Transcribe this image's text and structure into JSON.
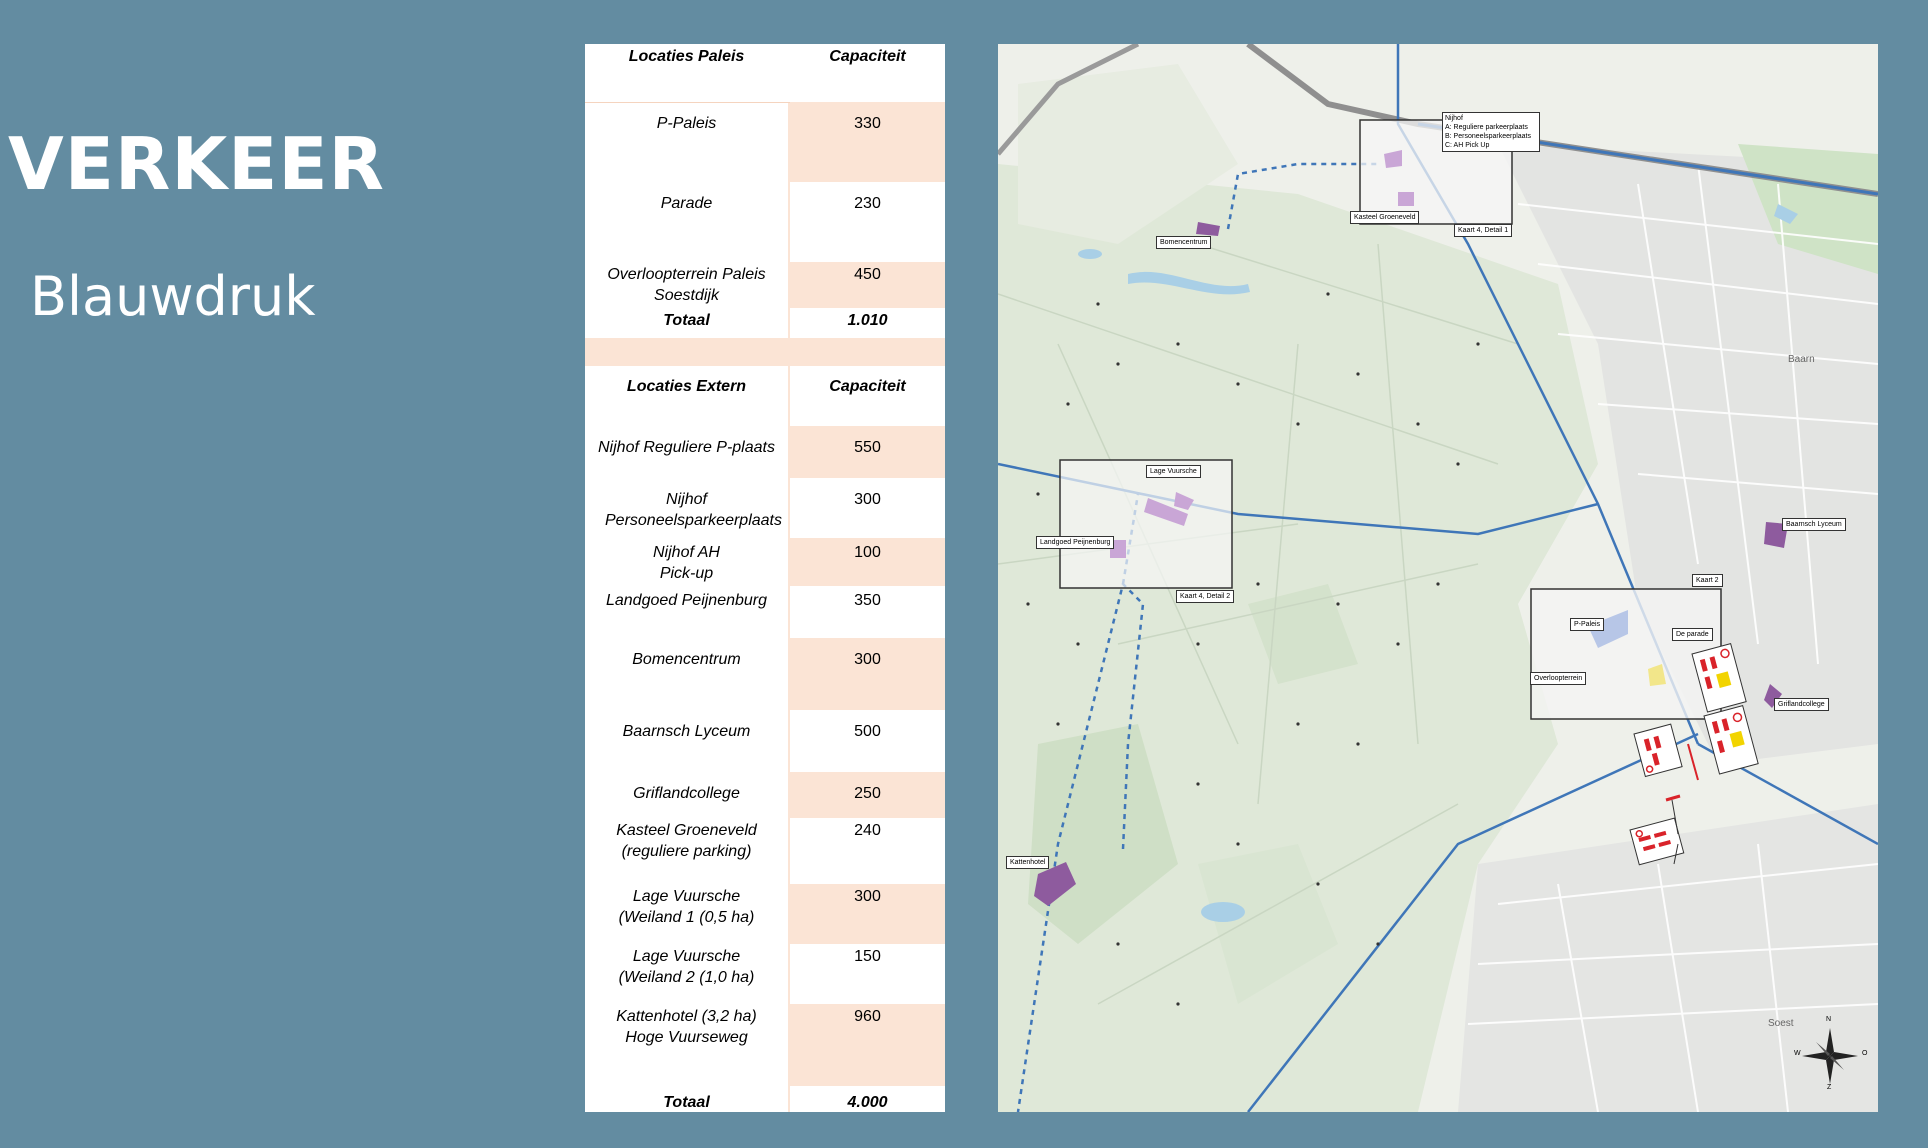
{
  "slide": {
    "title": "VERKEER",
    "subtitle": "Blauwdruk"
  },
  "table": {
    "section1": {
      "header": [
        "Locaties Paleis",
        "Capaciteit"
      ],
      "rows": [
        {
          "name": "P-Paleis",
          "capacity": "330"
        },
        {
          "name": "Parade",
          "capacity": "230"
        },
        {
          "name": "Overloopterrein Paleis Soestdijk",
          "capacity": "450"
        }
      ],
      "total": {
        "label": "Totaal",
        "value": "1.010"
      }
    },
    "section2": {
      "header": [
        "Locaties Extern",
        "Capaciteit"
      ],
      "rows": [
        {
          "name": "Nijhof Reguliere P-plaats",
          "capacity": "550"
        },
        {
          "name": "Nijhof Personeelsparkeerplaats",
          "capacity": "300"
        },
        {
          "name": "Nijhof AH Pick-up",
          "capacity": "100"
        },
        {
          "name": "Landgoed Peijnenburg",
          "capacity": "350"
        },
        {
          "name": "Bomencentrum",
          "capacity": "300"
        },
        {
          "name": "Baarnsch Lyceum",
          "capacity": "500"
        },
        {
          "name": "Griflandcollege",
          "capacity": "250"
        },
        {
          "name": "Kasteel Groeneveld (reguliere parking)",
          "capacity": "240"
        },
        {
          "name": "Lage Vuursche (Weiland 1 (0,5 ha)",
          "capacity": "300"
        },
        {
          "name": "Lage Vuursche (Weiland 2 (1,0 ha)",
          "capacity": "150"
        },
        {
          "name": "Kattenhotel (3,2 ha) Hoge Vuurseweg",
          "capacity": "960"
        }
      ],
      "total": {
        "label": "Totaal",
        "value": "4.000"
      }
    }
  },
  "map": {
    "labels": {
      "nijhof_title": "Nijhof",
      "nijhof_a": "A: Reguliere parkeerplaats",
      "nijhof_b": "B: Personeelsparkeerplaats",
      "nijhof_c": "C: AH Pick Up",
      "kasteel": "Kasteel Groeneveld",
      "kaart4_detail1": "Kaart 4, Detail 1",
      "bomencentrum": "Bomencentrum",
      "lage_vuursche": "Lage Vuursche",
      "landgoed": "Landgoed Peijnenburg",
      "kaart4_detail2": "Kaart 4, Detail 2",
      "baarnsch": "Baarnsch Lyceum",
      "kaart2": "Kaart 2",
      "ppaleis": "P-Paleis",
      "deparade": "De parade",
      "overloop": "Overloopterrein",
      "grifland": "Griflandcollege",
      "kattenhotel": "Kattenhotel",
      "baarn": "Baarn",
      "soest": "Soest",
      "compass_n": "N",
      "compass_o": "O",
      "compass_w": "W",
      "compass_z": "Z"
    },
    "colors": {
      "route": "#3f76b8",
      "parking": "#8e5b9e",
      "highlight": "#f2d400",
      "warning": "#d9232a"
    }
  }
}
